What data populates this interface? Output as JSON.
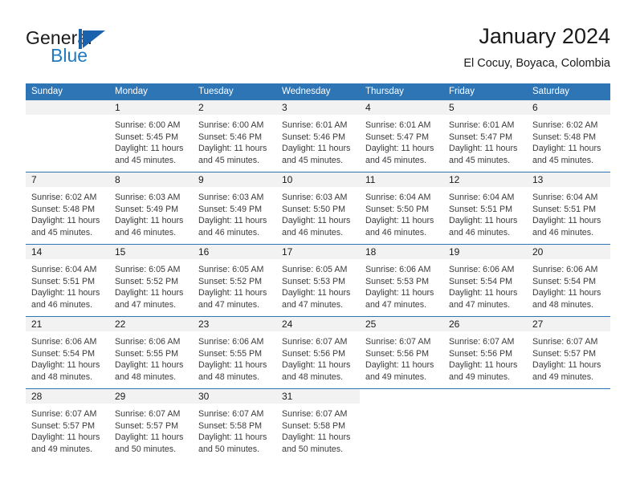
{
  "brand": {
    "name_part1": "General",
    "name_part2": "Blue",
    "mark": "triangle-logo"
  },
  "header": {
    "title": "January 2024",
    "subtitle": "El Cocuy, Boyaca, Colombia"
  },
  "colors": {
    "header_blue": "#2E75B6",
    "brand_blue": "#1F7AC0",
    "day_band_gray": "#F2F2F2",
    "text": "#1A1A1A"
  },
  "weekdays": [
    "Sunday",
    "Monday",
    "Tuesday",
    "Wednesday",
    "Thursday",
    "Friday",
    "Saturday"
  ],
  "weeks": [
    [
      {
        "day": "",
        "sunrise": "",
        "sunset": "",
        "daylight1": "",
        "daylight2": ""
      },
      {
        "day": "1",
        "sunrise": "Sunrise: 6:00 AM",
        "sunset": "Sunset: 5:45 PM",
        "daylight1": "Daylight: 11 hours",
        "daylight2": "and 45 minutes."
      },
      {
        "day": "2",
        "sunrise": "Sunrise: 6:00 AM",
        "sunset": "Sunset: 5:46 PM",
        "daylight1": "Daylight: 11 hours",
        "daylight2": "and 45 minutes."
      },
      {
        "day": "3",
        "sunrise": "Sunrise: 6:01 AM",
        "sunset": "Sunset: 5:46 PM",
        "daylight1": "Daylight: 11 hours",
        "daylight2": "and 45 minutes."
      },
      {
        "day": "4",
        "sunrise": "Sunrise: 6:01 AM",
        "sunset": "Sunset: 5:47 PM",
        "daylight1": "Daylight: 11 hours",
        "daylight2": "and 45 minutes."
      },
      {
        "day": "5",
        "sunrise": "Sunrise: 6:01 AM",
        "sunset": "Sunset: 5:47 PM",
        "daylight1": "Daylight: 11 hours",
        "daylight2": "and 45 minutes."
      },
      {
        "day": "6",
        "sunrise": "Sunrise: 6:02 AM",
        "sunset": "Sunset: 5:48 PM",
        "daylight1": "Daylight: 11 hours",
        "daylight2": "and 45 minutes."
      }
    ],
    [
      {
        "day": "7",
        "sunrise": "Sunrise: 6:02 AM",
        "sunset": "Sunset: 5:48 PM",
        "daylight1": "Daylight: 11 hours",
        "daylight2": "and 45 minutes."
      },
      {
        "day": "8",
        "sunrise": "Sunrise: 6:03 AM",
        "sunset": "Sunset: 5:49 PM",
        "daylight1": "Daylight: 11 hours",
        "daylight2": "and 46 minutes."
      },
      {
        "day": "9",
        "sunrise": "Sunrise: 6:03 AM",
        "sunset": "Sunset: 5:49 PM",
        "daylight1": "Daylight: 11 hours",
        "daylight2": "and 46 minutes."
      },
      {
        "day": "10",
        "sunrise": "Sunrise: 6:03 AM",
        "sunset": "Sunset: 5:50 PM",
        "daylight1": "Daylight: 11 hours",
        "daylight2": "and 46 minutes."
      },
      {
        "day": "11",
        "sunrise": "Sunrise: 6:04 AM",
        "sunset": "Sunset: 5:50 PM",
        "daylight1": "Daylight: 11 hours",
        "daylight2": "and 46 minutes."
      },
      {
        "day": "12",
        "sunrise": "Sunrise: 6:04 AM",
        "sunset": "Sunset: 5:51 PM",
        "daylight1": "Daylight: 11 hours",
        "daylight2": "and 46 minutes."
      },
      {
        "day": "13",
        "sunrise": "Sunrise: 6:04 AM",
        "sunset": "Sunset: 5:51 PM",
        "daylight1": "Daylight: 11 hours",
        "daylight2": "and 46 minutes."
      }
    ],
    [
      {
        "day": "14",
        "sunrise": "Sunrise: 6:04 AM",
        "sunset": "Sunset: 5:51 PM",
        "daylight1": "Daylight: 11 hours",
        "daylight2": "and 46 minutes."
      },
      {
        "day": "15",
        "sunrise": "Sunrise: 6:05 AM",
        "sunset": "Sunset: 5:52 PM",
        "daylight1": "Daylight: 11 hours",
        "daylight2": "and 47 minutes."
      },
      {
        "day": "16",
        "sunrise": "Sunrise: 6:05 AM",
        "sunset": "Sunset: 5:52 PM",
        "daylight1": "Daylight: 11 hours",
        "daylight2": "and 47 minutes."
      },
      {
        "day": "17",
        "sunrise": "Sunrise: 6:05 AM",
        "sunset": "Sunset: 5:53 PM",
        "daylight1": "Daylight: 11 hours",
        "daylight2": "and 47 minutes."
      },
      {
        "day": "18",
        "sunrise": "Sunrise: 6:06 AM",
        "sunset": "Sunset: 5:53 PM",
        "daylight1": "Daylight: 11 hours",
        "daylight2": "and 47 minutes."
      },
      {
        "day": "19",
        "sunrise": "Sunrise: 6:06 AM",
        "sunset": "Sunset: 5:54 PM",
        "daylight1": "Daylight: 11 hours",
        "daylight2": "and 47 minutes."
      },
      {
        "day": "20",
        "sunrise": "Sunrise: 6:06 AM",
        "sunset": "Sunset: 5:54 PM",
        "daylight1": "Daylight: 11 hours",
        "daylight2": "and 48 minutes."
      }
    ],
    [
      {
        "day": "21",
        "sunrise": "Sunrise: 6:06 AM",
        "sunset": "Sunset: 5:54 PM",
        "daylight1": "Daylight: 11 hours",
        "daylight2": "and 48 minutes."
      },
      {
        "day": "22",
        "sunrise": "Sunrise: 6:06 AM",
        "sunset": "Sunset: 5:55 PM",
        "daylight1": "Daylight: 11 hours",
        "daylight2": "and 48 minutes."
      },
      {
        "day": "23",
        "sunrise": "Sunrise: 6:06 AM",
        "sunset": "Sunset: 5:55 PM",
        "daylight1": "Daylight: 11 hours",
        "daylight2": "and 48 minutes."
      },
      {
        "day": "24",
        "sunrise": "Sunrise: 6:07 AM",
        "sunset": "Sunset: 5:56 PM",
        "daylight1": "Daylight: 11 hours",
        "daylight2": "and 48 minutes."
      },
      {
        "day": "25",
        "sunrise": "Sunrise: 6:07 AM",
        "sunset": "Sunset: 5:56 PM",
        "daylight1": "Daylight: 11 hours",
        "daylight2": "and 49 minutes."
      },
      {
        "day": "26",
        "sunrise": "Sunrise: 6:07 AM",
        "sunset": "Sunset: 5:56 PM",
        "daylight1": "Daylight: 11 hours",
        "daylight2": "and 49 minutes."
      },
      {
        "day": "27",
        "sunrise": "Sunrise: 6:07 AM",
        "sunset": "Sunset: 5:57 PM",
        "daylight1": "Daylight: 11 hours",
        "daylight2": "and 49 minutes."
      }
    ],
    [
      {
        "day": "28",
        "sunrise": "Sunrise: 6:07 AM",
        "sunset": "Sunset: 5:57 PM",
        "daylight1": "Daylight: 11 hours",
        "daylight2": "and 49 minutes."
      },
      {
        "day": "29",
        "sunrise": "Sunrise: 6:07 AM",
        "sunset": "Sunset: 5:57 PM",
        "daylight1": "Daylight: 11 hours",
        "daylight2": "and 50 minutes."
      },
      {
        "day": "30",
        "sunrise": "Sunrise: 6:07 AM",
        "sunset": "Sunset: 5:58 PM",
        "daylight1": "Daylight: 11 hours",
        "daylight2": "and 50 minutes."
      },
      {
        "day": "31",
        "sunrise": "Sunrise: 6:07 AM",
        "sunset": "Sunset: 5:58 PM",
        "daylight1": "Daylight: 11 hours",
        "daylight2": "and 50 minutes."
      },
      {
        "day": "",
        "sunrise": "",
        "sunset": "",
        "daylight1": "",
        "daylight2": ""
      },
      {
        "day": "",
        "sunrise": "",
        "sunset": "",
        "daylight1": "",
        "daylight2": ""
      },
      {
        "day": "",
        "sunrise": "",
        "sunset": "",
        "daylight1": "",
        "daylight2": ""
      }
    ]
  ]
}
